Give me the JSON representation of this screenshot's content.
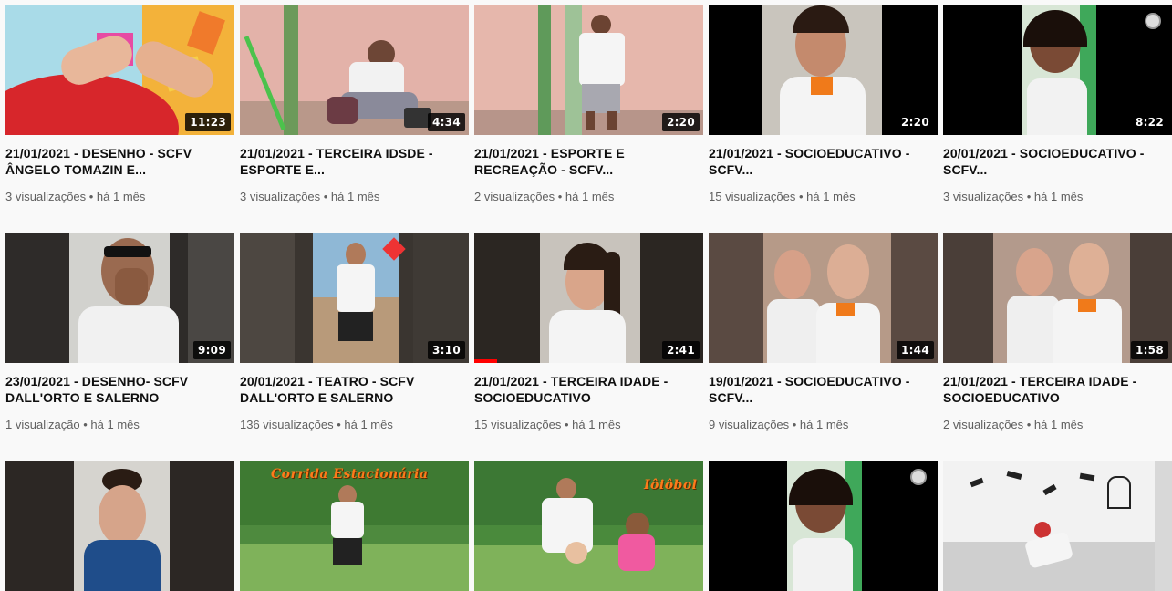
{
  "videos": [
    {
      "title": "21/01/2021 - DESENHO - SCFV ÂNGELO TOMAZIN E...",
      "meta": "3 visualizações • há 1 mês",
      "duration": "11:23"
    },
    {
      "title": "21/01/2021 - TERCEIRA IDSDE - ESPORTE E...",
      "meta": "3 visualizações • há 1 mês",
      "duration": "4:34"
    },
    {
      "title": "21/01/2021 - ESPORTE E RECREAÇÃO - SCFV...",
      "meta": "2 visualizações • há 1 mês",
      "duration": "2:20"
    },
    {
      "title": "21/01/2021 - SOCIOEDUCATIVO - SCFV...",
      "meta": "15 visualizações • há 1 mês",
      "duration": "2:20"
    },
    {
      "title": "20/01/2021 - SOCIOEDUCATIVO - SCFV...",
      "meta": "3 visualizações • há 1 mês",
      "duration": "8:22"
    },
    {
      "title": "23/01/2021 - DESENHO- SCFV DALL'ORTO E SALERNO",
      "meta": "1 visualização • há 1 mês",
      "duration": "9:09"
    },
    {
      "title": "20/01/2021 - TEATRO - SCFV DALL'ORTO E SALERNO",
      "meta": "136 visualizações • há 1 mês",
      "duration": "3:10"
    },
    {
      "title": "21/01/2021 - TERCEIRA IDADE - SOCIOEDUCATIVO",
      "meta": "15 visualizações • há 1 mês",
      "duration": "2:41",
      "progress": 0.1
    },
    {
      "title": "19/01/2021 - SOCIOEDUCATIVO - SCFV...",
      "meta": "9 visualizações • há 1 mês",
      "duration": "1:44"
    },
    {
      "title": "21/01/2021 - TERCEIRA IDADE - SOCIOEDUCATIVO",
      "meta": "2 visualizações • há 1 mês",
      "duration": "1:58"
    }
  ],
  "partial_thumbs": [
    {
      "overlay": ""
    },
    {
      "overlay": "Corrida Estacionária"
    },
    {
      "overlay": "Iôiôbol"
    },
    {
      "overlay": ""
    },
    {
      "overlay": ""
    }
  ],
  "colors": {
    "background": "#f9f9f9",
    "title": "#0f0f0f",
    "meta": "#606060",
    "progress": "#ff0000",
    "badge": "#000000"
  }
}
